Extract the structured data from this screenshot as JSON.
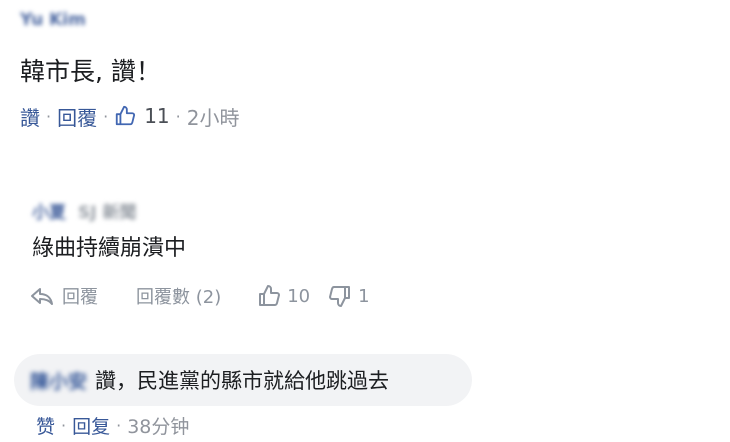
{
  "comment1": {
    "author": "Yu Kim",
    "text": "韓市長, 讚！",
    "actions": {
      "like_label": "讚",
      "reply_label": "回覆",
      "like_count": "11",
      "time": "2小時"
    }
  },
  "comment2": {
    "author": "小夏",
    "author_sub": "SJ 新聞",
    "text": "綠曲持續崩潰中",
    "actions": {
      "reply_label": "回覆",
      "reply_count_label": "回覆數 (2)",
      "like_count": "10",
      "dislike_count": "1"
    }
  },
  "comment3": {
    "author": "陳小安",
    "text": "讚，民進黨的縣市就給他跳過去",
    "actions": {
      "like_label": "赞",
      "reply_label": "回复",
      "time": "38分钟"
    }
  },
  "colors": {
    "link": "#385898",
    "muted": "#90949c",
    "bubble": "#f2f3f5"
  },
  "icons": [
    "thumbs-up-icon",
    "reply-arrow-icon",
    "thumbs-up-outline-icon",
    "thumbs-down-outline-icon"
  ]
}
